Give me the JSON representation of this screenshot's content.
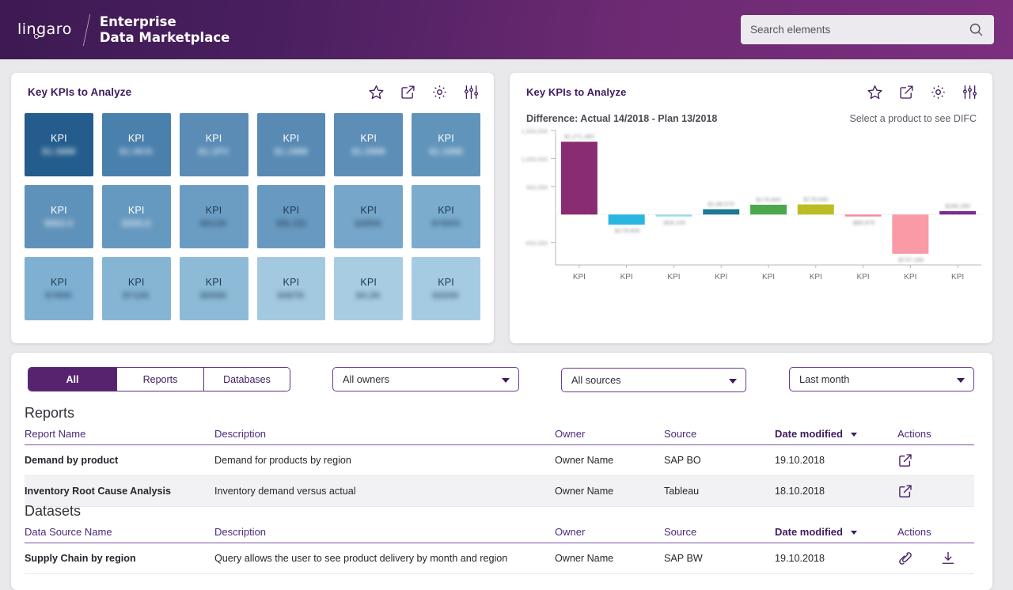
{
  "header": {
    "logo_text": "lingaro",
    "title_line1": "Enterprise",
    "title_line2": "Data Marketplace",
    "search_placeholder": "Search elements",
    "search_value": "",
    "search_icon": "search-icon"
  },
  "kpi_card": {
    "title": "Key KPIs to Analyze",
    "icons": [
      "star-icon",
      "external-link-icon",
      "gear-icon",
      "sliders-icon"
    ],
    "tiles": [
      {
        "label": "KPI",
        "value": "$1.3MM",
        "color": "#245d8d",
        "text": "#ffffff"
      },
      {
        "label": "KPI",
        "value": "$1.4K/h",
        "color": "#4a80ac",
        "text": "#ffffff"
      },
      {
        "label": "KPI",
        "value": "$1.1PV",
        "color": "#5a8cb5",
        "text": "#ffffff"
      },
      {
        "label": "KPI",
        "value": "$1.1MM",
        "color": "#588ab4",
        "text": "#ffffff"
      },
      {
        "label": "KPI",
        "value": "$1.2MM",
        "color": "#5c8eb7",
        "text": "#ffffff"
      },
      {
        "label": "KPI",
        "value": "$1.1MM",
        "color": "#6094ba",
        "text": "#ffffff"
      },
      {
        "label": "KPI",
        "value": "$952.0",
        "color": "#5f92ba",
        "text": "#ffffff"
      },
      {
        "label": "KPI",
        "value": "$305.0",
        "color": "#6699c0",
        "text": "#ffffff"
      },
      {
        "label": "KPI",
        "value": "$612K",
        "color": "#6b9dc3",
        "text": "#1d3a52"
      },
      {
        "label": "KPI",
        "value": "$5L/25",
        "color": "#6899c0",
        "text": "#1d3a52"
      },
      {
        "label": "KPI",
        "value": "$480K",
        "color": "#76a6c9",
        "text": "#1d3a52"
      },
      {
        "label": "KPI",
        "value": "$790/h",
        "color": "#7bacce",
        "text": "#1d3a52"
      },
      {
        "label": "KPI",
        "value": "$780K",
        "color": "#7fb0d1",
        "text": "#1d3a52"
      },
      {
        "label": "KPI",
        "value": "$712K",
        "color": "#86b5d4",
        "text": "#1d3a52"
      },
      {
        "label": "KPI",
        "value": "$600K",
        "color": "#8dbad7",
        "text": "#1d3a52"
      },
      {
        "label": "KPI",
        "value": "$467K",
        "color": "#a2c9e0",
        "text": "#1d3a52"
      },
      {
        "label": "KPI",
        "value": "$4.2K",
        "color": "#a8cde3",
        "text": "#1d3a52"
      },
      {
        "label": "KPI",
        "value": "$420K",
        "color": "#a5cbe2",
        "text": "#1d3a52"
      }
    ]
  },
  "chart_card": {
    "title": "Key KPIs to Analyze",
    "subtitle": "Difference: Actual 14/2018 - Plan 13/2018",
    "hint": "Select a product to see DIFC",
    "icons": [
      "star-icon",
      "external-link-icon",
      "gear-icon",
      "sliders-icon"
    ]
  },
  "chart_data": {
    "type": "bar",
    "title": "Difference: Actual 14/2018 - Plan 13/2018",
    "xlabel": "",
    "ylabel": "",
    "categories": [
      "KPI",
      "KPI",
      "KPI",
      "KPI",
      "KPI",
      "KPI",
      "KPI",
      "KPI",
      "KPI"
    ],
    "values": [
      1300000,
      -180000,
      -30000,
      95000,
      175000,
      180000,
      -8000,
      -700000,
      60000
    ],
    "bar_colors": [
      "#8a2c71",
      "#29b6e0",
      "#9fd9ef",
      "#1c7a93",
      "#4ba94b",
      "#bcbd22",
      "#f68b9a",
      "#fa9aa6",
      "#7b2d8e"
    ],
    "data_labels": [
      "$1,271,385",
      "-$178,600",
      "-$39,100",
      "$1,88,575",
      "$178,940",
      "$178,640",
      "-$88,975",
      "-$737,185",
      "$286,280"
    ],
    "ytick_labels": [
      "1,500,000",
      "1,000,000",
      "500,000",
      "-500,000"
    ],
    "ylim": [
      -900000,
      1500000
    ],
    "grid": false,
    "legend": "none",
    "baseline": 0
  },
  "list_panel": {
    "segmented": [
      {
        "label": "All",
        "active": true
      },
      {
        "label": "Reports",
        "active": false
      },
      {
        "label": "Databases",
        "active": false
      }
    ],
    "dropdowns": [
      {
        "name": "owners",
        "value": "All owners"
      },
      {
        "name": "sources",
        "value": "All sources"
      },
      {
        "name": "date",
        "value": "Last month"
      }
    ],
    "reports": {
      "section_title": "Reports",
      "columns": [
        "Report Name",
        "Description",
        "Owner",
        "Source",
        "Date modified",
        "Actions"
      ],
      "sorted_column": "Date modified",
      "rows": [
        {
          "name": "Demand by product",
          "description": "Demand for products by region",
          "owner": "Owner Name",
          "source": "SAP BO",
          "date": "19.10.2018",
          "actions": [
            "external-link-icon"
          ]
        },
        {
          "name": "Inventory Root Cause Analysis",
          "description": "Inventory demand versus actual",
          "owner": "Owner Name",
          "source": "Tableau",
          "date": "18.10.2018",
          "actions": [
            "external-link-icon"
          ]
        }
      ]
    },
    "datasets": {
      "section_title": "Datasets",
      "columns": [
        "Data Source Name",
        "Description",
        "Owner",
        "Source",
        "Date modified",
        "Actions"
      ],
      "sorted_column": "Date modified",
      "rows": [
        {
          "name": "Supply Chain by region",
          "description": "Query allows the user to see product delivery by month and region",
          "owner": "Owner Name",
          "source": "SAP BW",
          "date": "19.10.2018",
          "actions": [
            "link-icon",
            "download-icon"
          ]
        }
      ]
    }
  },
  "colors": {
    "brand_purple": "#3f1a5e",
    "accent_purple": "#57236e",
    "header_gradient_start": "#3d1a52",
    "header_gradient_end": "#7b2f7d"
  }
}
